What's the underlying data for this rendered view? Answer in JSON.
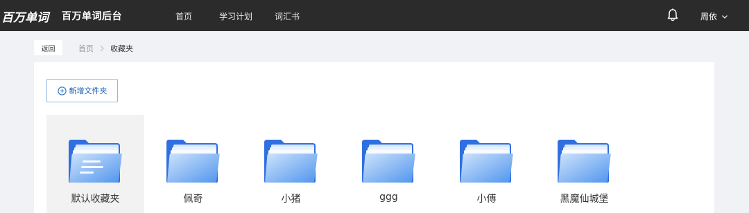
{
  "header": {
    "logo_text": "百万单词",
    "app_title": "百万单词后台",
    "nav": [
      {
        "label": "首页"
      },
      {
        "label": "学习计划"
      },
      {
        "label": "词汇书"
      }
    ],
    "user_name": "周依"
  },
  "breadcrumb": {
    "back_label": "返回",
    "home": "首页",
    "current": "收藏夹"
  },
  "toolbar": {
    "add_folder_label": "新增文件夹"
  },
  "folders": [
    {
      "name": "默认收藏夹",
      "selected": true
    },
    {
      "name": "佩奇"
    },
    {
      "name": "小猪"
    },
    {
      "name": "ggg"
    },
    {
      "name": "小傅"
    },
    {
      "name": "黑魔仙城堡"
    }
  ],
  "colors": {
    "topbar": "#2b2b2b",
    "accent": "#1b5fb7",
    "folder_back": "#2f6fe0",
    "folder_front": "#4f9af2"
  }
}
